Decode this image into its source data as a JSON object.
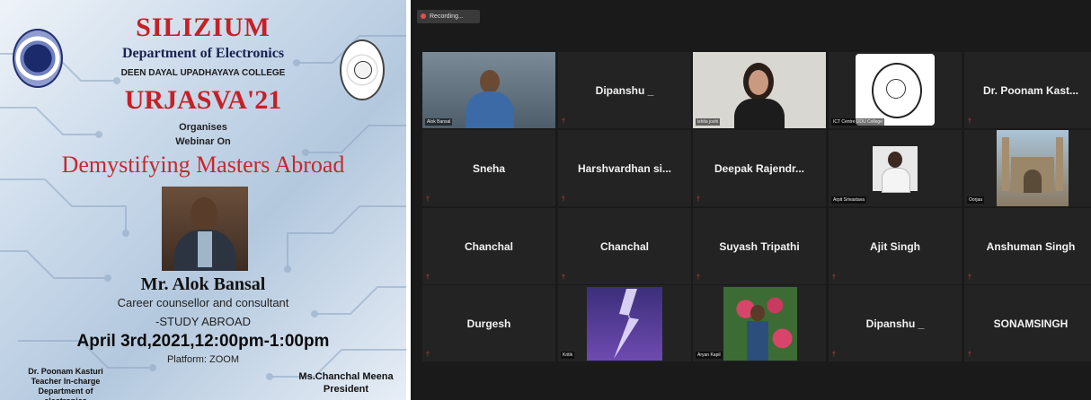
{
  "poster": {
    "brand": "SILIZIUM",
    "department": "Department of Electronics",
    "college": "DEEN DAYAL UPADHAYAYA COLLEGE",
    "event": "URJASVA'21",
    "organises": "Organises",
    "webinar_on": "Webinar On",
    "topic": "Demystifying Masters Abroad",
    "speaker_name": "Mr. Alok Bansal",
    "speaker_role": "Career counsellor and consultant",
    "speaker_sub": "-STUDY ABROAD",
    "date_time": "April 3rd,2021,12:00pm-1:00pm",
    "platform": "Platform: ZOOM",
    "teacher_incharge": [
      "Dr. Poonam Kasturi",
      "Teacher In-charge",
      "Department of electronics"
    ],
    "president": [
      "Ms.Chanchal Meena",
      "President"
    ]
  },
  "zoom": {
    "recording_label": "Recording...",
    "tiles": [
      {
        "name": "",
        "label": "Alok Bansal",
        "type": "video-man",
        "active": true
      },
      {
        "name": "Dipanshu _",
        "label": "",
        "type": "name"
      },
      {
        "name": "",
        "label": "ishita joshi",
        "type": "video-girl"
      },
      {
        "name": "",
        "label": "ICT Centre DDU College",
        "type": "video-logo"
      },
      {
        "name": "Dr. Poonam Kast...",
        "label": "",
        "type": "name"
      },
      {
        "name": "Sneha",
        "label": "",
        "type": "name"
      },
      {
        "name": "Harshvardhan si...",
        "label": "",
        "type": "name"
      },
      {
        "name": "Deepak Rajendr...",
        "label": "",
        "type": "name"
      },
      {
        "name": "",
        "label": "Arpit Srivastava",
        "type": "photo-boy"
      },
      {
        "name": "",
        "label": "Oorjaa",
        "type": "photo-charminar"
      },
      {
        "name": "Chanchal",
        "label": "",
        "type": "name"
      },
      {
        "name": "Chanchal",
        "label": "",
        "type": "name"
      },
      {
        "name": "Suyash Tripathi",
        "label": "",
        "type": "name"
      },
      {
        "name": "Ajit Singh",
        "label": "",
        "type": "name"
      },
      {
        "name": "Anshuman Singh",
        "label": "",
        "type": "name"
      },
      {
        "name": "Durgesh",
        "label": "",
        "type": "name"
      },
      {
        "name": "",
        "label": "Kritik",
        "type": "photo-lightning"
      },
      {
        "name": "",
        "label": "Aryan Kapil",
        "type": "photo-flowers"
      },
      {
        "name": "Dipanshu _",
        "label": "",
        "type": "name"
      },
      {
        "name": "SONAMSINGH",
        "label": "",
        "type": "name"
      }
    ]
  }
}
